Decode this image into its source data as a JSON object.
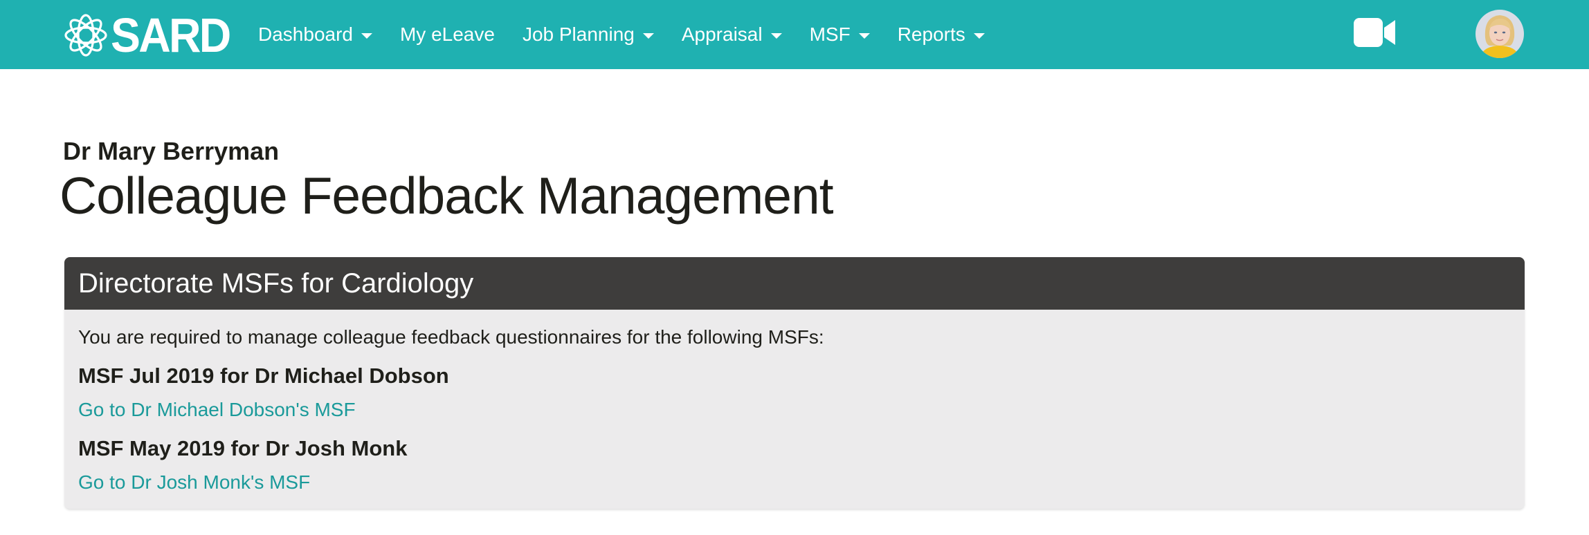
{
  "brand": {
    "name": "SARD",
    "logo_icon": "sard-logo-icon"
  },
  "nav": {
    "items": [
      {
        "label": "Dashboard",
        "has_dropdown": true
      },
      {
        "label": "My eLeave",
        "has_dropdown": false
      },
      {
        "label": "Job Planning",
        "has_dropdown": true
      },
      {
        "label": "Appraisal",
        "has_dropdown": true
      },
      {
        "label": "MSF",
        "has_dropdown": true
      },
      {
        "label": "Reports",
        "has_dropdown": true
      }
    ],
    "video_icon": "video-camera-icon",
    "avatar_icon": "user-avatar"
  },
  "page": {
    "user_name": "Dr Mary Berryman",
    "title": "Colleague Feedback Management"
  },
  "panel": {
    "header": "Directorate MSFs for Cardiology",
    "intro": "You are required to manage colleague feedback questionnaires for the following MSFs:",
    "msfs": [
      {
        "title": "MSF Jul 2019 for Dr Michael Dobson",
        "link": "Go to Dr Michael Dobson's MSF"
      },
      {
        "title": "MSF May 2019 for Dr Josh Monk",
        "link": "Go to Dr Josh Monk's MSF"
      }
    ]
  },
  "colors": {
    "navbar": "#1fb1b1",
    "panel_header": "#3e3d3c",
    "panel_body": "#ecebec",
    "link": "#1a9a9a"
  }
}
